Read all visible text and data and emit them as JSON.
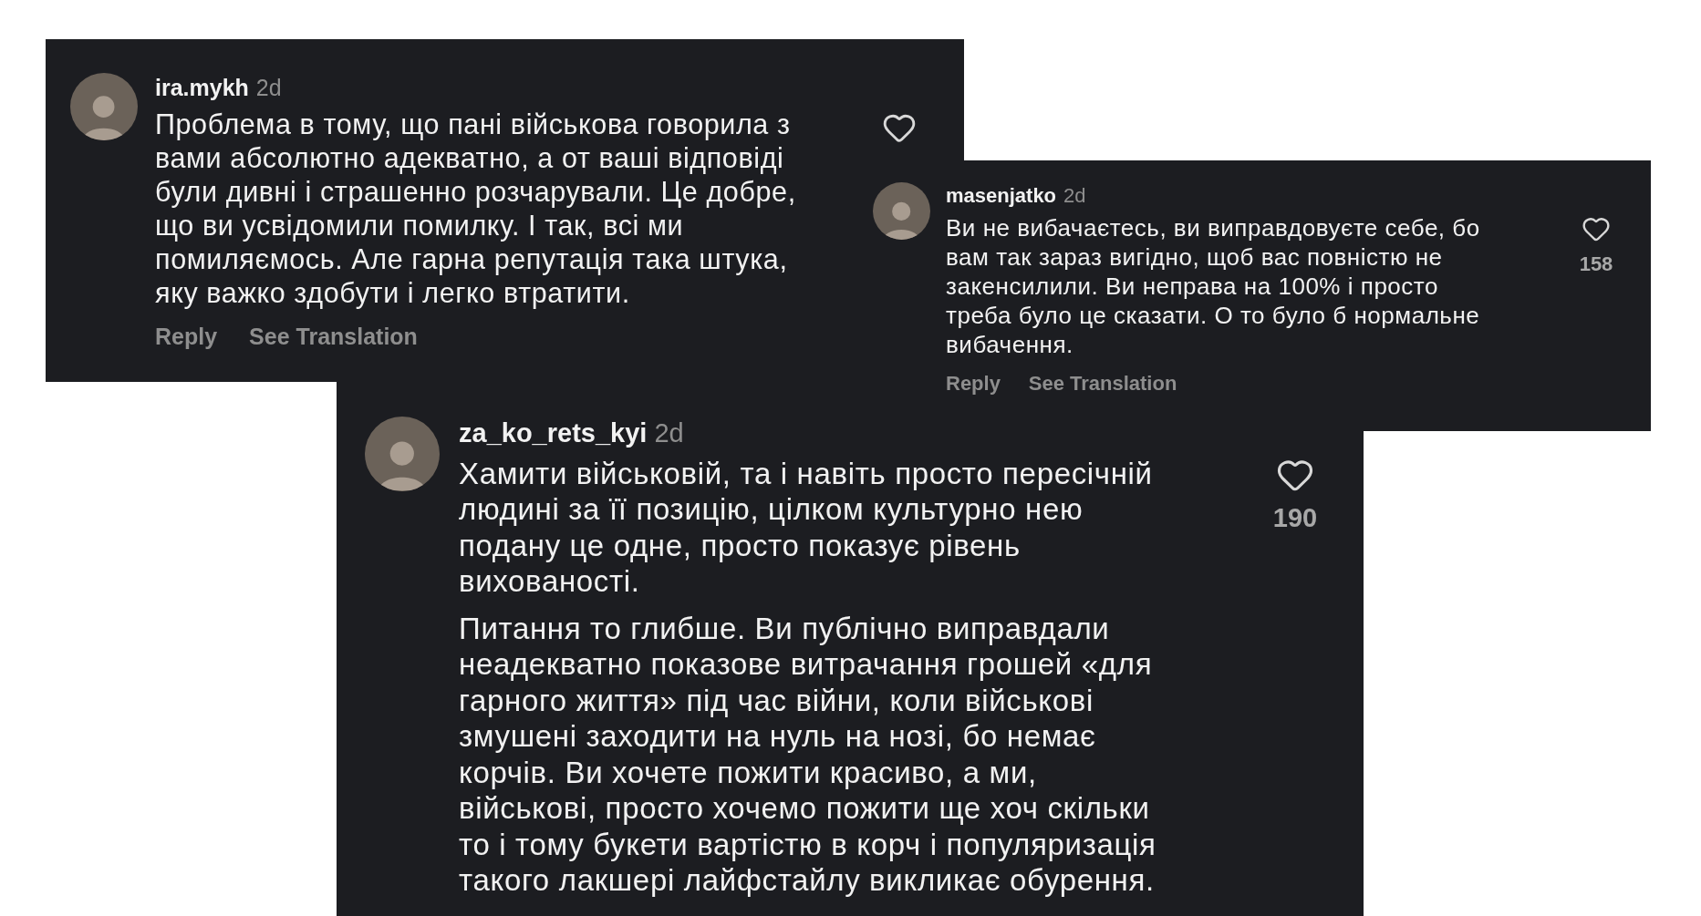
{
  "comments": [
    {
      "username": "ira.mykh",
      "time": "2d",
      "paragraphs": [
        "Проблема в тому, що пані військова говорила з\nвами абсолютно адекватно, а от ваші відповіді\nбули дивні і страшенно розчарували. Це добре,\nщо ви усвідомили помилку. І так, всі ми\nпомиляємось. Але гарна репутація така штука,\nяку важко здобути і легко втратити."
      ],
      "actions": [
        "Reply",
        "See Translation"
      ]
    },
    {
      "username": "masenjatko",
      "time": "2d",
      "paragraphs": [
        "Ви не вибачаєтесь, ви виправдовуєте себе, бо\nвам так зараз вигідно, щоб вас повністю не\nзакенсилили. Ви неправа на 100% і просто\nтреба було це сказати. О то було б нормальне\nвибачення."
      ],
      "likes": "158",
      "actions": [
        "Reply",
        "See Translation"
      ]
    },
    {
      "username": "za_ko_rets_kyi",
      "time": "2d",
      "paragraphs": [
        "Хамити військовій, та і навіть просто пересічній\nлюдині за її позицію, цілком культурно нею\nподану це одне, просто показує рівень\nвихованості.",
        "Питання то глибше. Ви публічно виправдали\nнеадекватно показове витрачання грошей «для\nгарного життя» під час війни, коли військові\nзмушені заходити на нуль на нозі, бо немає\nкорчів. Ви хочете пожити красиво, а ми,\nвійськові, просто хочемо пожити ще хоч скільки\nто і тому букети вартістю в корч і популяризація\nтакого лакшері лайфстайлу викликає обурення."
      ],
      "likes": "190"
    }
  ]
}
